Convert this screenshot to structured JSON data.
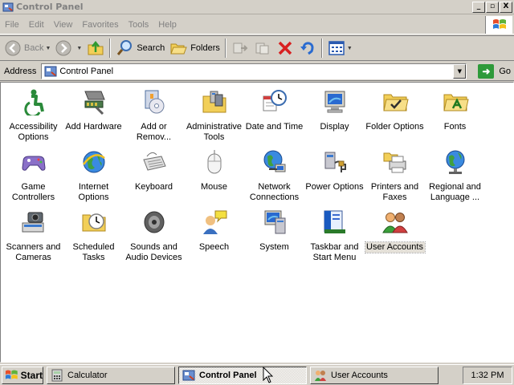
{
  "window": {
    "title": "Control Panel",
    "controls": {
      "minimize": "_",
      "maximize": "▫",
      "close": "X"
    }
  },
  "menu": [
    "File",
    "Edit",
    "View",
    "Favorites",
    "Tools",
    "Help"
  ],
  "toolbar": {
    "back": "Back",
    "search": "Search",
    "folders": "Folders"
  },
  "address": {
    "label": "Address",
    "value": "Control Panel",
    "go": "Go"
  },
  "items": [
    {
      "label": "Accessibility Options",
      "icon": "accessibility-icon"
    },
    {
      "label": "Add Hardware",
      "icon": "add-hardware-icon"
    },
    {
      "label": "Add or Remov...",
      "icon": "add-remove-programs-icon"
    },
    {
      "label": "Administrative Tools",
      "icon": "administrative-tools-icon"
    },
    {
      "label": "Date and Time",
      "icon": "date-time-icon"
    },
    {
      "label": "Display",
      "icon": "display-icon"
    },
    {
      "label": "Folder Options",
      "icon": "folder-options-icon"
    },
    {
      "label": "Fonts",
      "icon": "fonts-icon"
    },
    {
      "label": "Game Controllers",
      "icon": "game-controllers-icon"
    },
    {
      "label": "Internet Options",
      "icon": "internet-options-icon"
    },
    {
      "label": "Keyboard",
      "icon": "keyboard-icon"
    },
    {
      "label": "Mouse",
      "icon": "mouse-icon"
    },
    {
      "label": "Network Connections",
      "icon": "network-connections-icon"
    },
    {
      "label": "Power Options",
      "icon": "power-options-icon"
    },
    {
      "label": "Printers and Faxes",
      "icon": "printers-faxes-icon"
    },
    {
      "label": "Regional and Language ...",
      "icon": "regional-language-icon"
    },
    {
      "label": "Scanners and Cameras",
      "icon": "scanners-cameras-icon"
    },
    {
      "label": "Scheduled Tasks",
      "icon": "scheduled-tasks-icon"
    },
    {
      "label": "Sounds and Audio Devices",
      "icon": "sounds-audio-icon"
    },
    {
      "label": "Speech",
      "icon": "speech-icon"
    },
    {
      "label": "System",
      "icon": "system-icon"
    },
    {
      "label": "Taskbar and Start Menu",
      "icon": "taskbar-start-menu-icon"
    },
    {
      "label": "User Accounts",
      "icon": "user-accounts-icon",
      "selected": true
    }
  ],
  "taskbar": {
    "start": "Start",
    "tasks": [
      {
        "label": "Calculator",
        "active": false
      },
      {
        "label": "Control Panel",
        "active": true
      },
      {
        "label": "User Accounts",
        "active": false
      }
    ],
    "clock": "1:32 PM"
  }
}
